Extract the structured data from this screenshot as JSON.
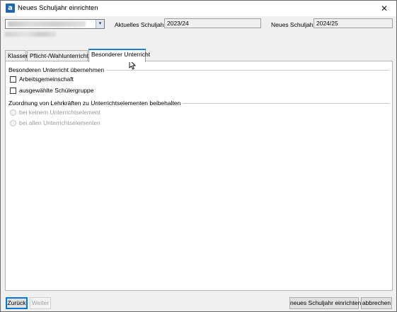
{
  "window": {
    "title": "Neues Schuljahr einrichten",
    "app_icon_letter": "a",
    "close_symbol": "✕"
  },
  "header": {
    "school_select_arrow": "▾",
    "current_year_label": "Aktuelles Schuljahr",
    "current_year_value": "2023/24",
    "new_year_label": "Neues Schuljahr",
    "new_year_value": "2024/25"
  },
  "tabs": [
    {
      "label": "Klassen",
      "active": false
    },
    {
      "label": "Pflicht-/Wahlunterricht",
      "active": false
    },
    {
      "label": "Besonderer Unterricht",
      "active": true
    }
  ],
  "panel": {
    "group1": {
      "title": "Besonderen Unterricht übernehmen",
      "checkboxes": [
        {
          "label": "Arbeitsgemeinschaft",
          "checked": false
        },
        {
          "label": "ausgewählte Schülergruppe",
          "checked": false
        }
      ]
    },
    "group2": {
      "title": "Zuordnung von Lehrkräften zu Unterrichtselementen beibehalten",
      "radios": [
        {
          "label": "bei keinem Unterrichtselement",
          "selected": false,
          "enabled": false
        },
        {
          "label": "bei allen Unterrichtselementen",
          "selected": false,
          "enabled": false
        }
      ]
    }
  },
  "footer": {
    "back_label": "Zurück",
    "next_label": "Weiter",
    "create_label": "neues Schuljahr einrichten",
    "cancel_label": "abbrechen"
  },
  "colors": {
    "accent": "#1a7fd0",
    "app_icon": "#1f67b1"
  }
}
